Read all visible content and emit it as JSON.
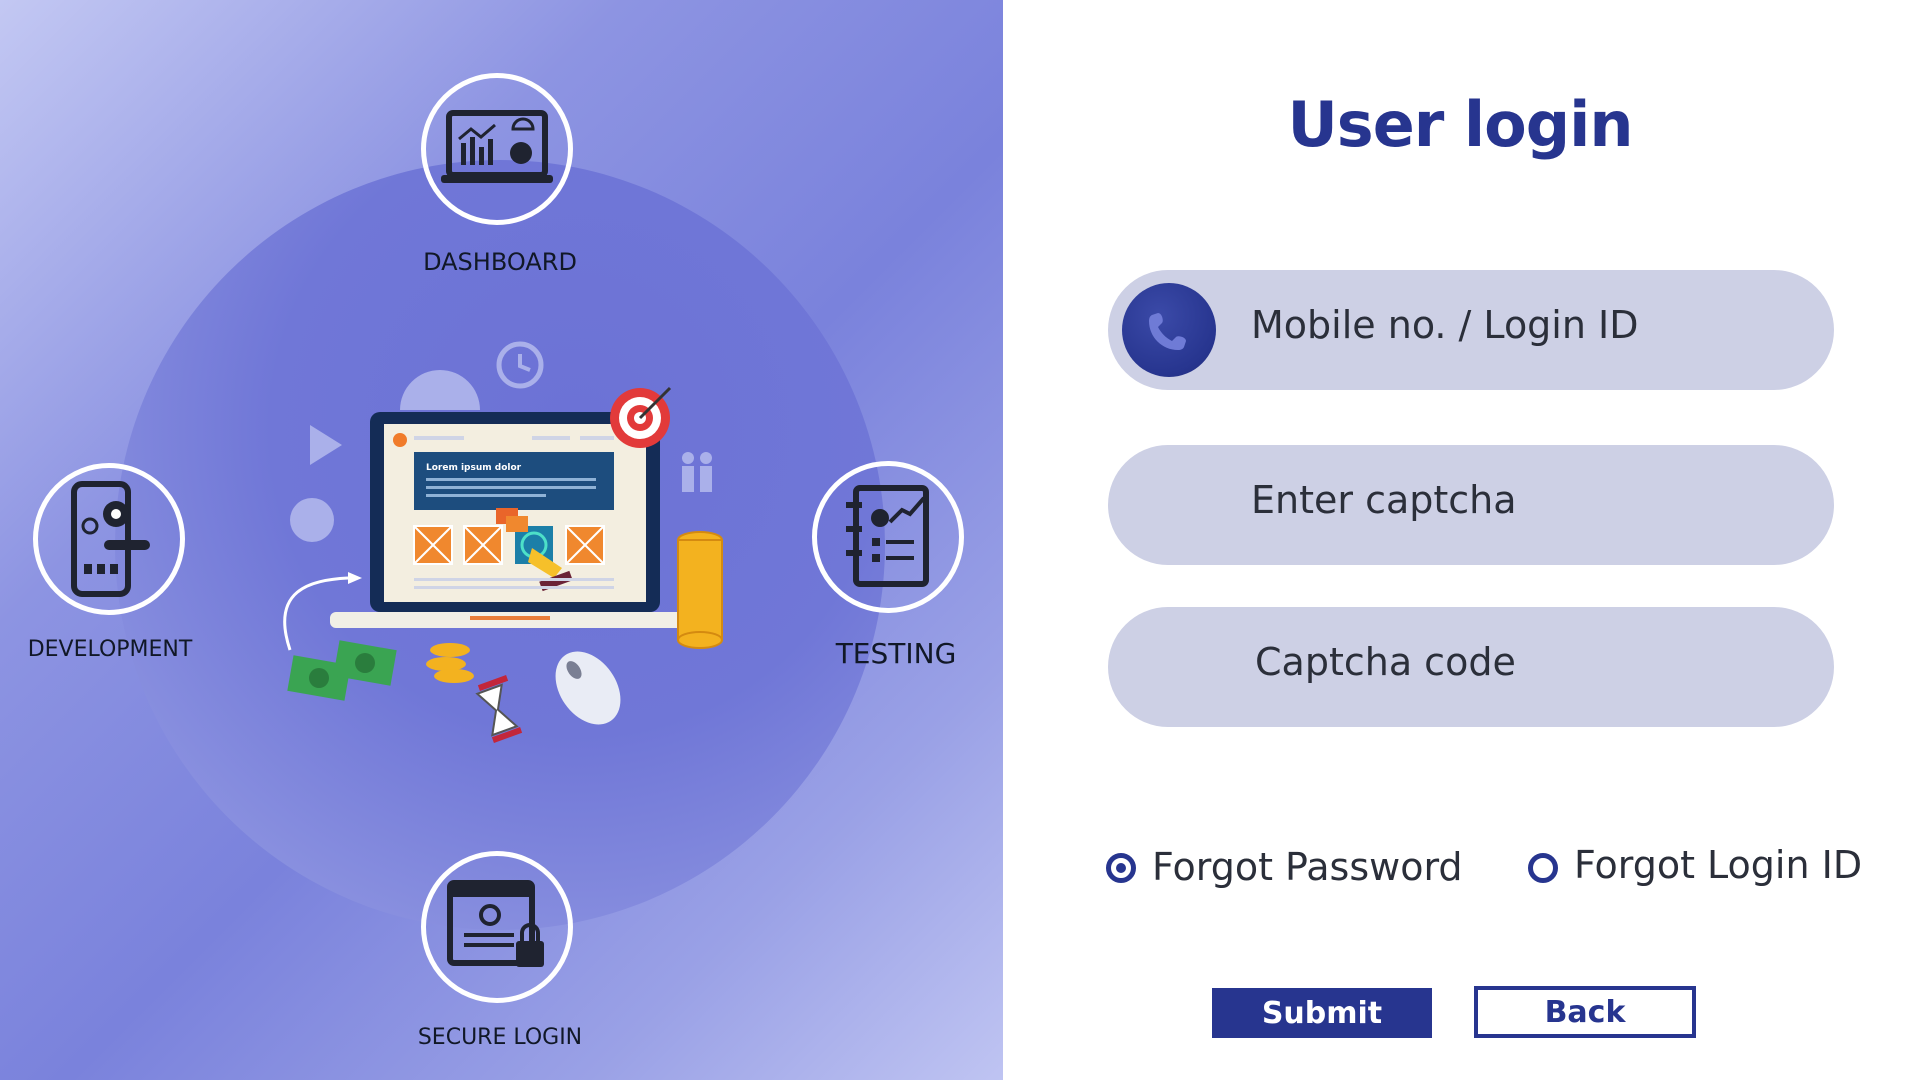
{
  "illustration": {
    "nodes": {
      "dashboard": "DASHBOARD",
      "development": "DEVELOPMENT",
      "testing": "TESTING",
      "secure_login": "SECURE LOGIN"
    },
    "laptop_screen_heading": "Lorem ipsum dolor",
    "icons": [
      "dashboard-monitor-icon",
      "mobile-gear-icon",
      "checklist-notebook-icon",
      "secure-login-window-icon",
      "laptop-icon",
      "target-icon",
      "coins-icon",
      "money-icon",
      "hourglass-icon",
      "mouse-icon",
      "globe-icon",
      "clock-icon",
      "play-icon",
      "flower-icon",
      "people-icon"
    ]
  },
  "login": {
    "title": "User login",
    "fields": {
      "mobile_login_id": "Mobile no. / Login ID",
      "enter_captcha": "Enter captcha",
      "captcha_code": "Captcha code"
    },
    "options": {
      "forgot_password": "Forgot Password",
      "forgot_login_id": "Forgot Login ID",
      "selected": "forgot_password"
    },
    "buttons": {
      "submit": "Submit",
      "back": "Back"
    }
  },
  "colors": {
    "accent": "#27358f",
    "field_bg": "#cdd0e5",
    "panel_gradient": [
      "#c3c8f3",
      "#7a82dc",
      "#bfc4f2"
    ]
  }
}
